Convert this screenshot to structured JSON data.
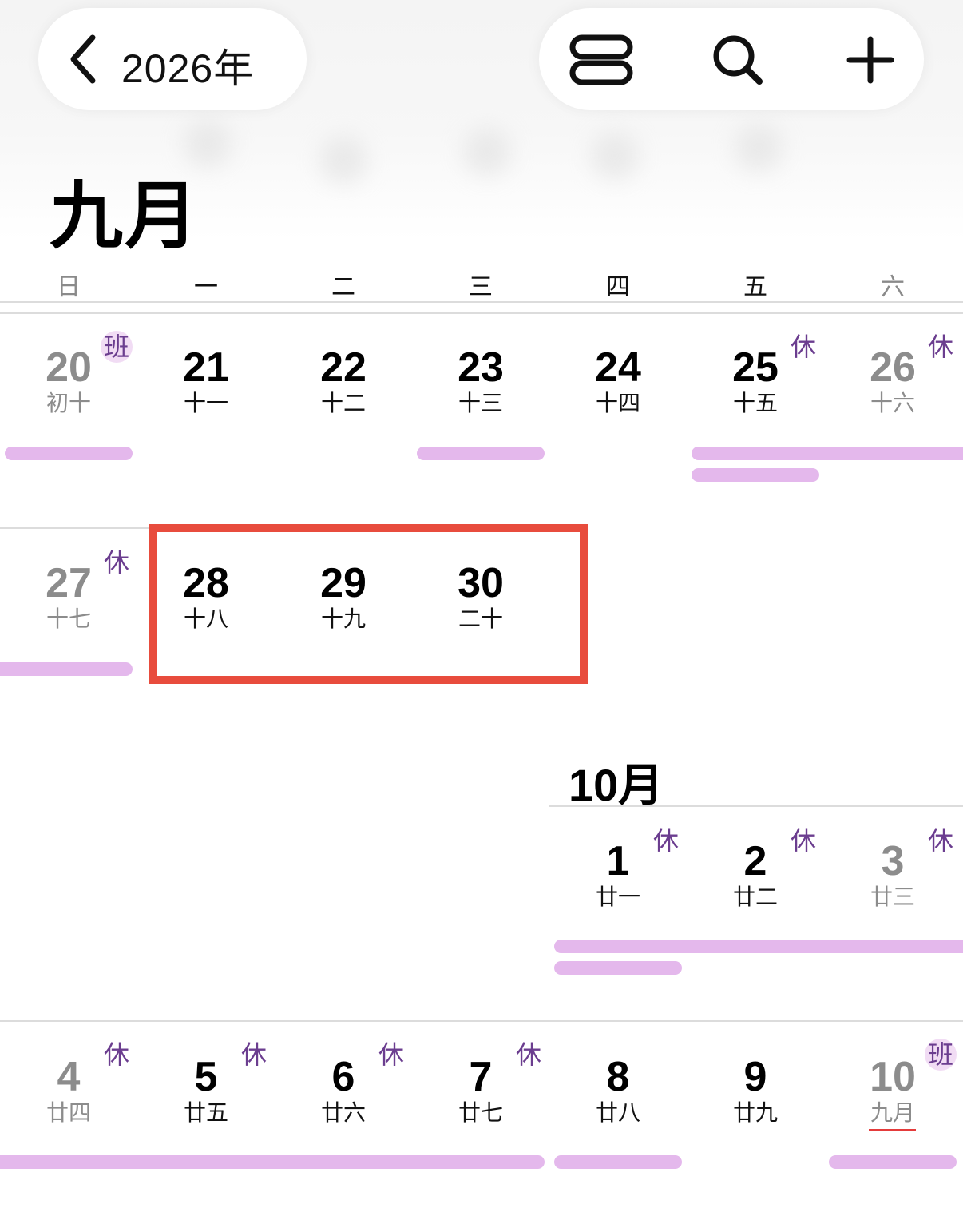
{
  "header": {
    "back_icon": "chevron-left-icon",
    "year_label": "2026年",
    "view_toggle_icon": "view-list-icon",
    "search_icon": "search-icon",
    "add_icon": "plus-icon"
  },
  "month_title": "九月",
  "weekdays": [
    "日",
    "一",
    "二",
    "三",
    "四",
    "五",
    "六"
  ],
  "weeks": {
    "w1": [
      {
        "day": "20",
        "lunar": "初十",
        "badge": "班"
      },
      {
        "day": "21",
        "lunar": "十一"
      },
      {
        "day": "22",
        "lunar": "十二"
      },
      {
        "day": "23",
        "lunar": "十三"
      },
      {
        "day": "24",
        "lunar": "十四"
      },
      {
        "day": "25",
        "lunar": "十五",
        "badge": "休"
      },
      {
        "day": "26",
        "lunar": "十六",
        "badge": "休"
      }
    ],
    "w2": [
      {
        "day": "27",
        "lunar": "十七",
        "badge": "休"
      },
      {
        "day": "28",
        "lunar": "十八"
      },
      {
        "day": "29",
        "lunar": "十九"
      },
      {
        "day": "30",
        "lunar": "二十"
      }
    ],
    "october_title": "10月",
    "w3": [
      {
        "day": "1",
        "lunar": "廿一",
        "badge": "休"
      },
      {
        "day": "2",
        "lunar": "廿二",
        "badge": "休"
      },
      {
        "day": "3",
        "lunar": "廿三",
        "badge": "休"
      }
    ],
    "w4": [
      {
        "day": "4",
        "lunar": "廿四",
        "badge": "休"
      },
      {
        "day": "5",
        "lunar": "廿五",
        "badge": "休"
      },
      {
        "day": "6",
        "lunar": "廿六",
        "badge": "休"
      },
      {
        "day": "7",
        "lunar": "廿七",
        "badge": "休"
      },
      {
        "day": "8",
        "lunar": "廿八"
      },
      {
        "day": "9",
        "lunar": "廿九"
      },
      {
        "day": "10",
        "lunar": "九月",
        "badge": "班"
      }
    ]
  },
  "colors": {
    "event_bar": "#e4b8ec",
    "badge_text": "#6b3d8f",
    "badge_bg": "#f1dcf4",
    "highlight_box": "#e84c3d",
    "today_underline": "#e43b3b"
  }
}
